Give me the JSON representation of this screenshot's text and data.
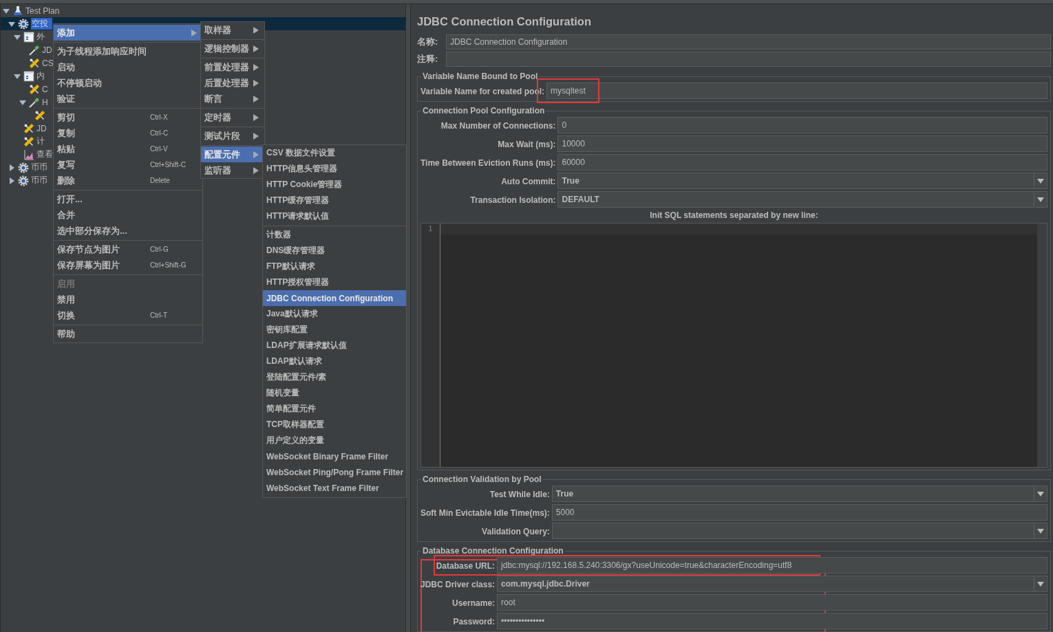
{
  "tree": {
    "items": [
      {
        "label": "Test Plan",
        "kind": "plan",
        "expanded": true,
        "selected": false,
        "children": [
          {
            "label": "空投",
            "kind": "thread_group",
            "expanded": true,
            "selected": true,
            "children": [
              {
                "label": "外",
                "kind": "controller",
                "expanded": true,
                "selected": false,
                "children": [
                  {
                    "label": "JD",
                    "kind": "sampler",
                    "selected": false
                  },
                  {
                    "label": "CS",
                    "kind": "config",
                    "selected": false
                  }
                ]
              },
              {
                "label": "内",
                "kind": "controller",
                "expanded": true,
                "selected": false,
                "children": [
                  {
                    "label": "C",
                    "kind": "config",
                    "selected": false
                  },
                  {
                    "label": "H",
                    "kind": "sampler",
                    "expanded": true,
                    "selected": false,
                    "children": [
                      {
                        "kind": "config",
                        "selected": false
                      }
                    ]
                  }
                ]
              },
              {
                "label": "JD",
                "kind": "config",
                "selected": false
              },
              {
                "label": "计",
                "kind": "config",
                "selected": false
              },
              {
                "label": "查看",
                "kind": "listener",
                "selected": false
              }
            ]
          },
          {
            "label": "币币",
            "kind": "thread_group",
            "expanded": false,
            "selected": false
          },
          {
            "label": "币币",
            "kind": "thread_group",
            "expanded": false,
            "selected": false
          }
        ]
      }
    ]
  },
  "context_menu": {
    "groups": [
      {
        "items": [
          {
            "label": "添加",
            "submenu": true,
            "selected": true,
            "disabled": false
          }
        ]
      },
      {
        "items": [
          {
            "label": "为子线程添加响应时间",
            "submenu": false,
            "selected": false,
            "disabled": false
          },
          {
            "label": "启动",
            "submenu": false,
            "selected": false,
            "disabled": false
          },
          {
            "label": "不停顿启动",
            "submenu": false,
            "selected": false,
            "disabled": false
          },
          {
            "label": "验证",
            "submenu": false,
            "selected": false,
            "disabled": false
          }
        ]
      },
      {
        "items": [
          {
            "label": "剪切",
            "shortcut": "Ctrl-X",
            "submenu": false,
            "selected": false,
            "disabled": false
          },
          {
            "label": "复制",
            "shortcut": "Ctrl-C",
            "submenu": false,
            "selected": false,
            "disabled": false
          },
          {
            "label": "粘贴",
            "shortcut": "Ctrl-V",
            "submenu": false,
            "selected": false,
            "disabled": false
          },
          {
            "label": "复写",
            "shortcut": "Ctrl+Shift-C",
            "submenu": false,
            "selected": false,
            "disabled": false
          },
          {
            "label": "删除",
            "shortcut": "Delete",
            "submenu": false,
            "selected": false,
            "disabled": false
          }
        ]
      },
      {
        "items": [
          {
            "label": "打开...",
            "submenu": false,
            "selected": false,
            "disabled": false
          },
          {
            "label": "合并",
            "submenu": false,
            "selected": false,
            "disabled": false
          },
          {
            "label": "选中部分保存为...",
            "submenu": false,
            "selected": false,
            "disabled": false
          }
        ]
      },
      {
        "items": [
          {
            "label": "保存节点为图片",
            "shortcut": "Ctrl-G",
            "submenu": false,
            "selected": false,
            "disabled": false
          },
          {
            "label": "保存屏幕为图片",
            "shortcut": "Ctrl+Shift-G",
            "submenu": false,
            "selected": false,
            "disabled": false
          }
        ]
      },
      {
        "items": [
          {
            "label": "启用",
            "submenu": false,
            "selected": false,
            "disabled": true
          },
          {
            "label": "禁用",
            "submenu": false,
            "selected": false,
            "disabled": false
          },
          {
            "label": "切换",
            "shortcut": "Ctrl-T",
            "submenu": false,
            "selected": false,
            "disabled": false
          }
        ]
      },
      {
        "items": [
          {
            "label": "帮助",
            "submenu": false,
            "selected": false,
            "disabled": false
          }
        ]
      }
    ]
  },
  "add_submenu": {
    "groups": [
      {
        "items": [
          {
            "label": "取样器",
            "submenu": true,
            "selected": false
          }
        ]
      },
      {
        "items": [
          {
            "label": "逻辑控制器",
            "submenu": true,
            "selected": false
          }
        ]
      },
      {
        "items": [
          {
            "label": "前置处理器",
            "submenu": true,
            "selected": false
          },
          {
            "label": "后置处理器",
            "submenu": true,
            "selected": false
          },
          {
            "label": "断言",
            "submenu": true,
            "selected": false
          }
        ]
      },
      {
        "items": [
          {
            "label": "定时器",
            "submenu": true,
            "selected": false
          }
        ]
      },
      {
        "items": [
          {
            "label": "测试片段",
            "submenu": true,
            "selected": false
          }
        ]
      },
      {
        "items": [
          {
            "label": "配置元件",
            "submenu": true,
            "selected": true
          },
          {
            "label": "监听器",
            "submenu": true,
            "selected": false
          }
        ]
      }
    ]
  },
  "config_submenu": {
    "groups": [
      {
        "items": [
          {
            "label": "CSV 数据文件设置",
            "selected": false
          },
          {
            "label": "HTTP信息头管理器",
            "selected": false
          },
          {
            "label": "HTTP Cookie管理器",
            "selected": false
          },
          {
            "label": "HTTP缓存管理器",
            "selected": false
          },
          {
            "label": "HTTP请求默认值",
            "selected": false
          }
        ]
      },
      {
        "items": [
          {
            "label": "计数器",
            "selected": false
          },
          {
            "label": "DNS缓存管理器",
            "selected": false
          },
          {
            "label": "FTP默认请求",
            "selected": false
          },
          {
            "label": "HTTP授权管理器",
            "selected": false
          },
          {
            "label": "JDBC Connection Configuration",
            "selected": true
          },
          {
            "label": "Java默认请求",
            "selected": false
          },
          {
            "label": "密钥库配置",
            "selected": false
          },
          {
            "label": "LDAP扩展请求默认值",
            "selected": false
          },
          {
            "label": "LDAP默认请求",
            "selected": false
          },
          {
            "label": "登陆配置元件/素",
            "selected": false
          },
          {
            "label": "随机变量",
            "selected": false
          },
          {
            "label": "简单配置元件",
            "selected": false
          },
          {
            "label": "TCP取样器配置",
            "selected": false
          },
          {
            "label": "用户定义的变量",
            "selected": false
          },
          {
            "label": "WebSocket Binary Frame Filter",
            "selected": false
          },
          {
            "label": "WebSocket Ping/Pong Frame Filter",
            "selected": false
          },
          {
            "label": "WebSocket Text Frame Filter",
            "selected": false
          }
        ]
      }
    ]
  },
  "config": {
    "title": "JDBC Connection Configuration",
    "fields": [
      {
        "label": "名称:",
        "value": "JDBC Connection Configuration"
      },
      {
        "label": "注释:"
      }
    ],
    "sections": [
      {
        "title": "Variable Name Bound to Pool",
        "highlighted": false,
        "rows": [
          {
            "kind": "text",
            "label": "Variable Name for created pool:",
            "value": "mysqltest",
            "highlighted": true
          }
        ]
      },
      {
        "title": "Connection Pool Configuration",
        "highlighted": false,
        "rows": [
          {
            "kind": "text",
            "label": "Max Number of Connections:",
            "value": "0"
          },
          {
            "kind": "text",
            "label": "Max Wait (ms):",
            "value": "10000"
          },
          {
            "kind": "text",
            "label": "Time Between Eviction Runs (ms):",
            "value": "60000"
          },
          {
            "kind": "select",
            "label": "Auto Commit:",
            "value": "True"
          },
          {
            "kind": "select",
            "label": "Transaction Isolation:",
            "value": "DEFAULT"
          },
          {
            "kind": "editor",
            "label": "Init SQL statements separated by new line:",
            "line_numbers": [
              "1"
            ]
          }
        ]
      },
      {
        "title": "Connection Validation by Pool",
        "highlighted": false,
        "rows": [
          {
            "kind": "select",
            "label": "Test While Idle:",
            "value": "True"
          },
          {
            "kind": "text",
            "label": "Soft Min Evictable Idle Time(ms):",
            "value": "5000"
          },
          {
            "kind": "select",
            "label": "Validation Query:"
          }
        ]
      },
      {
        "title": "Database Connection Configuration",
        "highlighted": true,
        "rows": [
          {
            "kind": "text",
            "label": "Database URL:",
            "value": "jdbc:mysql://192.168.5.240:3306/gx?useUnicode=true&characterEncoding=utf8",
            "highlighted": true
          },
          {
            "kind": "select",
            "label": "JDBC Driver class:",
            "value": "com.mysql.jdbc.Driver"
          },
          {
            "kind": "text",
            "label": "Username:",
            "value": "root"
          },
          {
            "kind": "text",
            "label": "Password:",
            "value": "•••••••••••••••"
          }
        ]
      }
    ]
  }
}
